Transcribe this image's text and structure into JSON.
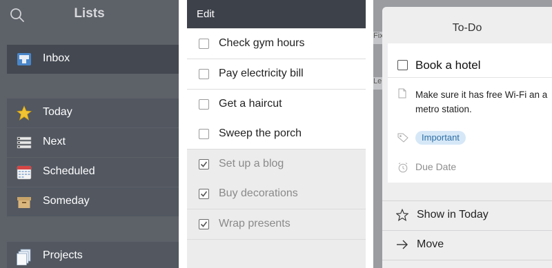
{
  "lists_panel": {
    "title": "Lists",
    "items": [
      {
        "label": "Inbox",
        "icon": "inbox-icon"
      },
      {
        "label": "Today",
        "icon": "star-icon"
      },
      {
        "label": "Next",
        "icon": "next-icon"
      },
      {
        "label": "Scheduled",
        "icon": "calendar-icon"
      },
      {
        "label": "Someday",
        "icon": "box-icon"
      },
      {
        "label": "Projects",
        "icon": "projects-icon"
      }
    ]
  },
  "todo_panel": {
    "edit_label": "Edit",
    "open_items": [
      "Check gym hours",
      "Pay electricity bill",
      "Get a haircut",
      "Sweep the porch"
    ],
    "done_items": [
      "Set up a blog",
      "Buy decorations",
      "Wrap presents"
    ]
  },
  "detail_panel": {
    "peek_labels": [
      "Fix",
      "Le"
    ],
    "title": "To-Do",
    "task_title": "Book a hotel",
    "note": "Make sure it has free Wi-Fi an a metro station.",
    "tag": "Important",
    "due_date_placeholder": "Due Date",
    "actions": [
      {
        "label": "Show in Today",
        "icon": "star-outline-icon"
      },
      {
        "label": "Move",
        "icon": "arrow-right-icon"
      }
    ]
  },
  "colors": {
    "sidebar_bg": "#5d6168",
    "selected_row": "#434851",
    "header_bg": "#3d414a",
    "tag_bg": "#d6e8f7",
    "tag_text": "#2f6fa6"
  }
}
